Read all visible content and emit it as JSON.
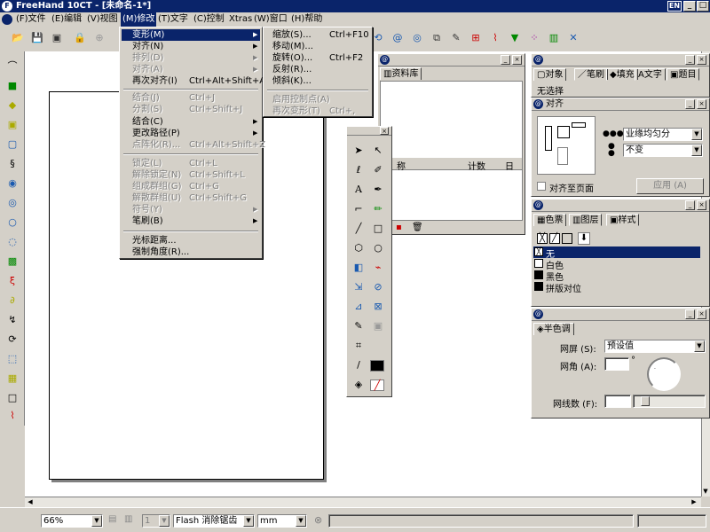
{
  "window": {
    "title": "FreeHand 10CT - [未命名-1*]",
    "lang": "EN"
  },
  "menubar": {
    "items": [
      "(F)文件",
      "(E)编辑",
      "(V)视图",
      "(M)修改",
      "(T)文字",
      "(C)控制",
      "Xtras",
      "(W)窗口",
      "(H)帮助"
    ]
  },
  "modify_menu": {
    "items": [
      {
        "label": "变形(M)",
        "shortcut": "",
        "submenu": true,
        "disabled": false,
        "highlighted": true
      },
      {
        "label": "对齐(N)",
        "shortcut": "",
        "submenu": true,
        "disabled": false
      },
      {
        "label": "排列(D)",
        "shortcut": "",
        "submenu": true,
        "disabled": true
      },
      {
        "label": "对齐(A)",
        "shortcut": "",
        "submenu": true,
        "disabled": true
      },
      {
        "label": "再次对齐(I)",
        "shortcut": "Ctrl+Alt+Shift+A",
        "submenu": false,
        "disabled": false
      },
      {
        "label": "结合(J)",
        "shortcut": "Ctrl+J",
        "submenu": false,
        "disabled": true
      },
      {
        "label": "分割(S)",
        "shortcut": "Ctrl+Shift+J",
        "submenu": false,
        "disabled": true
      },
      {
        "label": "结合(C)",
        "shortcut": "",
        "submenu": true,
        "disabled": false
      },
      {
        "label": "更改路径(P)",
        "shortcut": "",
        "submenu": true,
        "disabled": false
      },
      {
        "label": "点阵化(R)...",
        "shortcut": "Ctrl+Alt+Shift+Z",
        "submenu": false,
        "disabled": true
      },
      {
        "label": "锁定(L)",
        "shortcut": "Ctrl+L",
        "submenu": false,
        "disabled": true
      },
      {
        "label": "解除锁定(N)",
        "shortcut": "Ctrl+Shift+L",
        "submenu": false,
        "disabled": true
      },
      {
        "label": "组成群组(G)",
        "shortcut": "Ctrl+G",
        "submenu": false,
        "disabled": true
      },
      {
        "label": "解散群组(U)",
        "shortcut": "Ctrl+Shift+G",
        "submenu": false,
        "disabled": true
      },
      {
        "label": "符号(Y)",
        "shortcut": "",
        "submenu": true,
        "disabled": true
      },
      {
        "label": "笔刷(B)",
        "shortcut": "",
        "submenu": true,
        "disabled": false
      },
      {
        "label": "光标距离...",
        "shortcut": "",
        "submenu": false,
        "disabled": false
      },
      {
        "label": "强制角度(R)...",
        "shortcut": "",
        "submenu": false,
        "disabled": false
      }
    ]
  },
  "transform_submenu": {
    "items": [
      {
        "label": "缩放(S)...",
        "shortcut": "Ctrl+F10",
        "disabled": false
      },
      {
        "label": "移动(M)...",
        "shortcut": "",
        "disabled": false
      },
      {
        "label": "旋转(O)...",
        "shortcut": "Ctrl+F2",
        "disabled": false
      },
      {
        "label": "反射(R)...",
        "shortcut": "",
        "disabled": false
      },
      {
        "label": "倾斜(K)...",
        "shortcut": "",
        "disabled": false
      },
      {
        "label": "启用控制点(A)",
        "shortcut": "",
        "disabled": true
      },
      {
        "label": "再次变形(T)",
        "shortcut": "Ctrl+,",
        "disabled": true
      }
    ]
  },
  "library_panel": {
    "tab": "资料库",
    "col_name": "称",
    "col_count": "计数",
    "col_date": "日"
  },
  "object_panel": {
    "tabs": [
      "对象",
      "笔刷",
      "填充",
      "文字",
      "题目"
    ],
    "status": "无选择"
  },
  "align_panel": {
    "title": "对齐",
    "h_option": "业缘均匀分",
    "v_option": "不变",
    "align_to_page": "对齐至页面",
    "apply": "应用 (A)"
  },
  "color_panel": {
    "tabs": [
      "色票",
      "图层",
      "样式"
    ],
    "swatches": [
      {
        "name": "无",
        "color": "#ffffff",
        "selected": true
      },
      {
        "name": "白色",
        "color": "#ffffff",
        "selected": false
      },
      {
        "name": "黑色",
        "color": "#000000",
        "selected": false
      },
      {
        "name": "拼版对位",
        "color": "#000000",
        "selected": false
      }
    ]
  },
  "halftone_panel": {
    "tab": "半色调",
    "screen_label": "网屏 (S):",
    "screen_value": "预设值",
    "angle_label": "网角 (A):",
    "angle_unit": "°",
    "lines_label": "网线数 (F):"
  },
  "statusbar": {
    "zoom": "66%",
    "page": "1",
    "render_mode": "Flash 消除锯齿",
    "units": "mm"
  },
  "accent": "#0a246a"
}
